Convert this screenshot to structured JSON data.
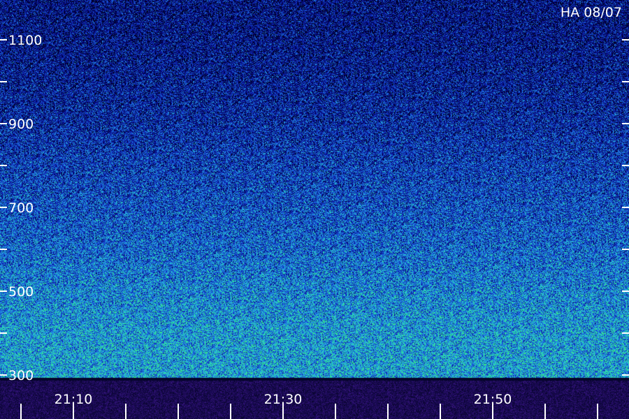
{
  "chart_data": {
    "type": "heatmap",
    "title": "",
    "corner_label": "HA 08/07",
    "xlabel": "",
    "ylabel": "",
    "y_ticks": [
      300,
      400,
      500,
      600,
      700,
      800,
      900,
      1000,
      1100,
      1200
    ],
    "y_labels": [
      {
        "value": 300,
        "text": "300"
      },
      {
        "value": 500,
        "text": "500"
      },
      {
        "value": 700,
        "text": "700"
      },
      {
        "value": 900,
        "text": "900"
      },
      {
        "value": 1100,
        "text": "1100"
      }
    ],
    "ylim": [
      300,
      1200
    ],
    "xlim": [
      "21:03",
      "21:63"
    ],
    "x_tick_step_minutes": 5,
    "x_labels": [
      "21:10",
      "21:30",
      "21:50"
    ],
    "colors": {
      "background": "#05052a",
      "low": "#000055",
      "mid": "#1f6fd8",
      "high": "#22dd99",
      "footer": "#1a0a55"
    },
    "intensity_profile": [
      {
        "freq": 300,
        "level": 0.62
      },
      {
        "freq": 400,
        "level": 0.6
      },
      {
        "freq": 500,
        "level": 0.54
      },
      {
        "freq": 600,
        "level": 0.46
      },
      {
        "freq": 700,
        "level": 0.4
      },
      {
        "freq": 800,
        "level": 0.34
      },
      {
        "freq": 900,
        "level": 0.27
      },
      {
        "freq": 1000,
        "level": 0.22
      },
      {
        "freq": 1100,
        "level": 0.18
      },
      {
        "freq": 1200,
        "level": 0.16
      }
    ]
  }
}
